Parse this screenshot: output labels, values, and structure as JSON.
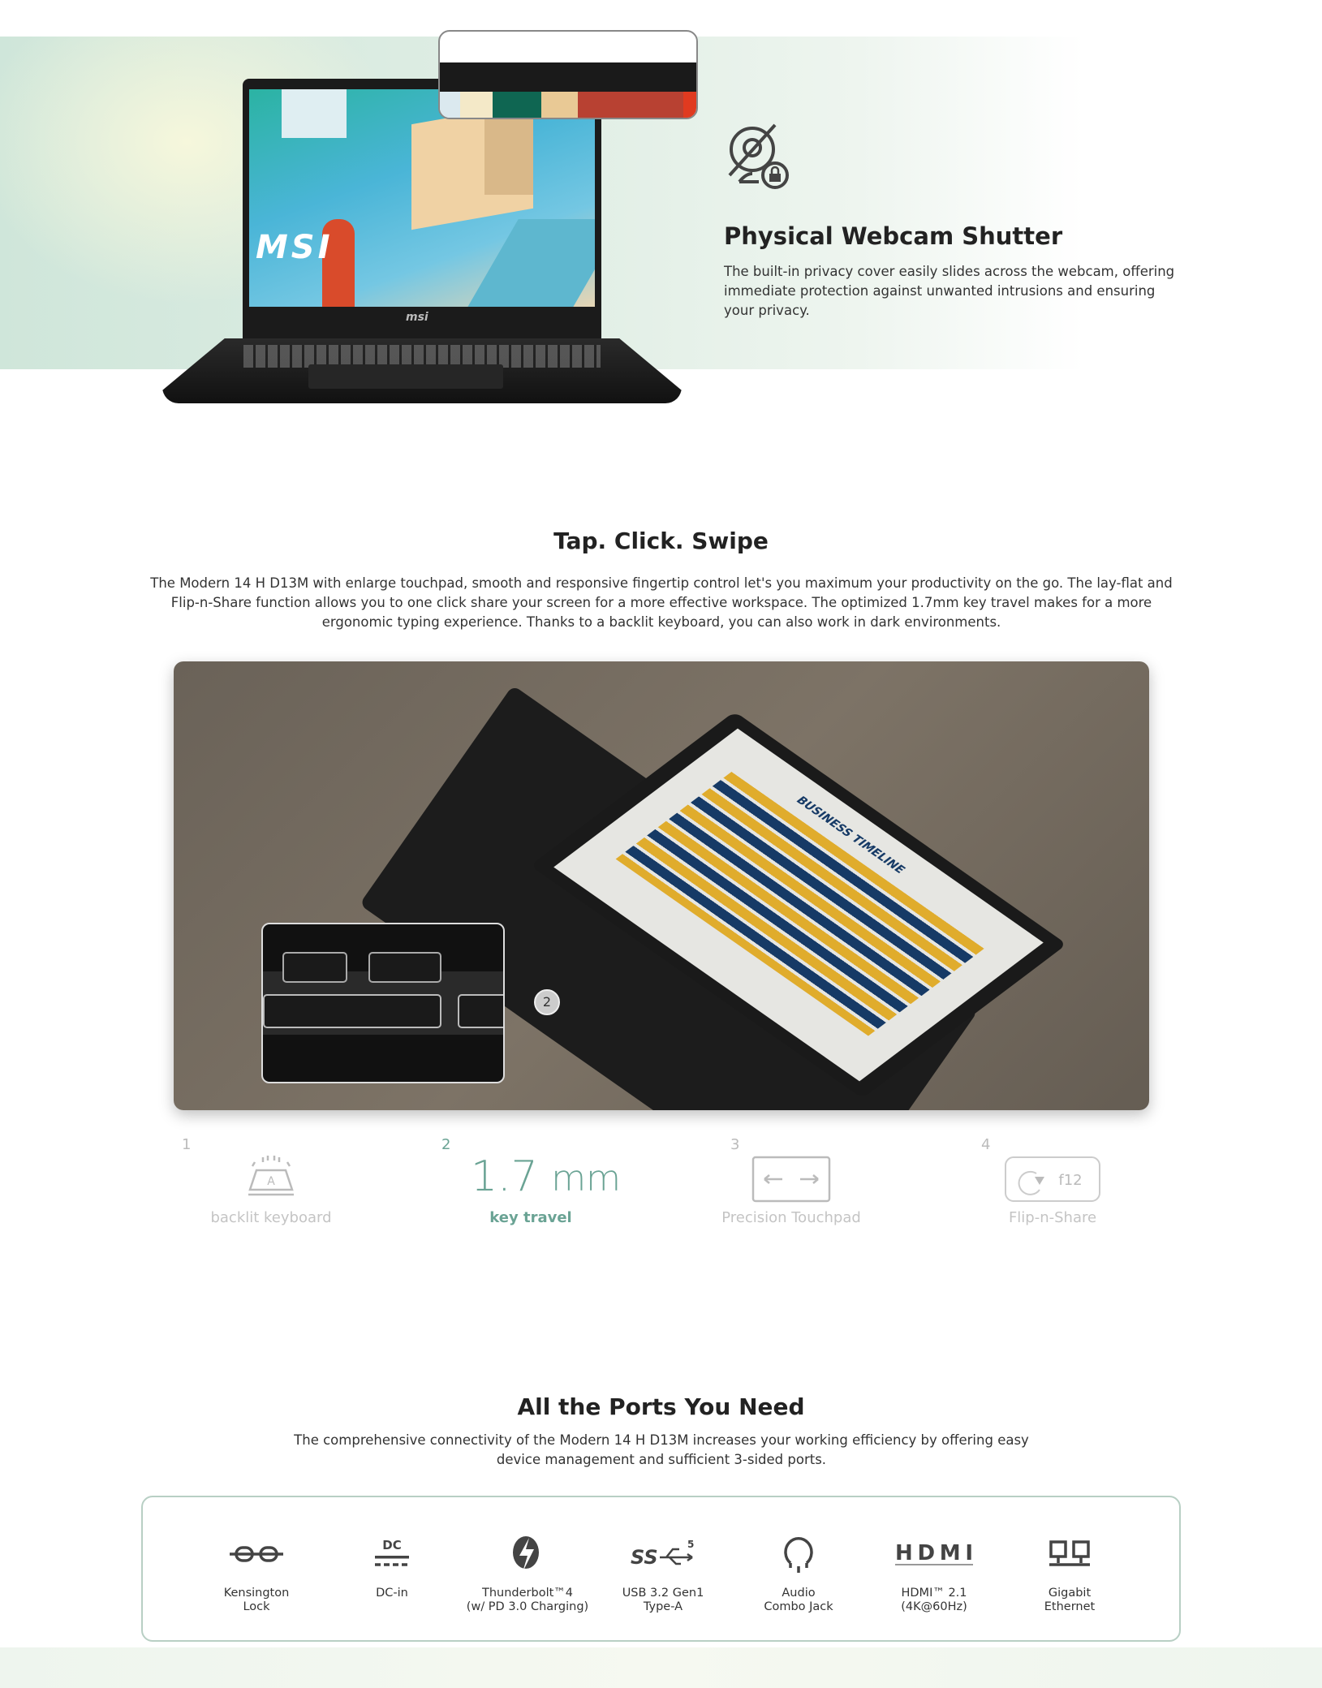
{
  "webcam": {
    "icon": "webcam-off-lock-icon",
    "title": "Physical Webcam Shutter",
    "text": "The built-in privacy cover easily slides across the webcam, offering immediate protection against unwanted intrusions and ensuring your privacy."
  },
  "laptop": {
    "screen_logo": "MSI",
    "lid_logo": "msi"
  },
  "touch": {
    "title": "Tap. Click. Swipe",
    "text": "The Modern 14 H D13M with enlarge touchpad, smooth and responsive fingertip control let's you maximum your productivity on the go. The lay-flat and Flip-n-Share function allows you to one click share your screen for a more effective workspace. The optimized 1.7mm key travel makes for a more ergonomic typing experience. Thanks to a backlit keyboard, you can also work in dark environments.",
    "photo_marker": "2",
    "screen_heading": "BUSINESS TIMELINE",
    "features": [
      {
        "num": "1",
        "label": "backlit keyboard",
        "icon": "backlit-keyboard-icon",
        "key": "A"
      },
      {
        "num": "2",
        "value": "1.7",
        "unit": "mm",
        "label": "key travel",
        "active": true
      },
      {
        "num": "3",
        "label": "Precision Touchpad",
        "icon": "touchpad-arrows-icon"
      },
      {
        "num": "4",
        "label": "Flip-n-Share",
        "icon": "flip-f12-icon",
        "key": "f12"
      }
    ],
    "accent": "#6aa394"
  },
  "ports": {
    "title": "All the Ports You Need",
    "text": "The comprehensive connectivity of the Modern 14 H D13M increases your working efficiency by offering easy device management and sufficient 3-sided ports.",
    "items": [
      {
        "icon": "kensington-lock-icon",
        "line1": "Kensington",
        "line2": "Lock"
      },
      {
        "icon": "dc-in-icon",
        "line1": "DC-in",
        "line2": "",
        "glyph": "DC"
      },
      {
        "icon": "thunderbolt-icon",
        "line1": "Thunderbolt™4",
        "line2": "(w/ PD 3.0 Charging)"
      },
      {
        "icon": "usb-ss5-icon",
        "line1": "USB 3.2 Gen1",
        "line2": "Type-A",
        "glyph": "SS",
        "sup": "5"
      },
      {
        "icon": "audio-jack-icon",
        "line1": "Audio",
        "line2": "Combo Jack"
      },
      {
        "icon": "hdmi-icon",
        "line1": "HDMI™ 2.1",
        "line2": "(4K@60Hz)",
        "glyph": "HDMI"
      },
      {
        "icon": "ethernet-icon",
        "line1": "Gigabit",
        "line2": "Ethernet"
      }
    ]
  }
}
